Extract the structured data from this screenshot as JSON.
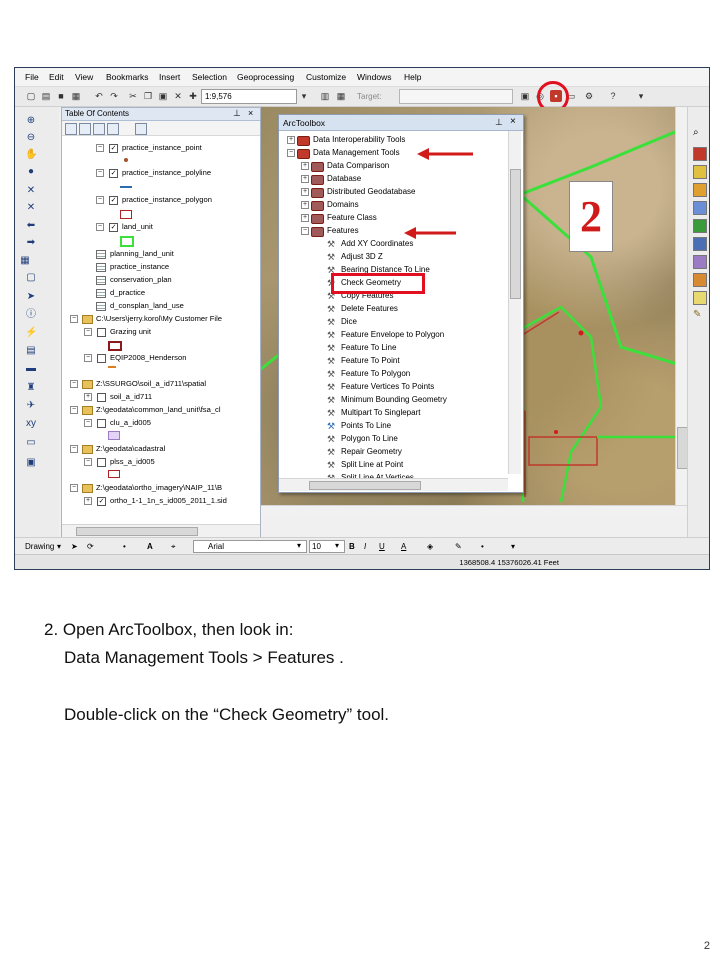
{
  "menu": [
    "File",
    "Edit",
    "View",
    "Bookmarks",
    "Insert",
    "Selection",
    "Geoprocessing",
    "Customize",
    "Windows",
    "Help"
  ],
  "toolbar": {
    "scale": "1:9,576",
    "target_label": "Target:"
  },
  "toc": {
    "title": "Table Of Contents",
    "items": [
      {
        "label": "practice_instance_point",
        "checked": true
      },
      {
        "label": "practice_instance_polyline",
        "checked": true
      },
      {
        "label": "practice_instance_polygon",
        "checked": true
      },
      {
        "label": "land_unit",
        "checked": true
      },
      {
        "label": "planning_land_unit"
      },
      {
        "label": "practice_instance"
      },
      {
        "label": "conservation_plan"
      },
      {
        "label": "d_practice"
      },
      {
        "label": "d_consplan_land_use"
      },
      {
        "label": "C:\\Users\\jerry.korol\\My Customer File"
      },
      {
        "label": "Grazing unit",
        "checked": false
      },
      {
        "label": "EQIP2008_Henderson",
        "checked": false
      },
      {
        "label": "Z:\\SSURGO\\soil_a_id711\\spatial"
      },
      {
        "label": "soil_a_id711",
        "checked": false
      },
      {
        "label": "Z:\\geodata\\common_land_unit\\fsa_cl"
      },
      {
        "label": "clu_a_id005",
        "checked": false
      },
      {
        "label": "Z:\\geodata\\cadastral"
      },
      {
        "label": "plss_a_id005",
        "checked": false
      },
      {
        "label": "Z:\\geodata\\ortho_imagery\\NAIP_11\\B"
      },
      {
        "label": "ortho_1-1_1n_s_id005_2011_1.sid",
        "checked": true
      }
    ]
  },
  "toolbox": {
    "title": "ArcToolbox",
    "groups": [
      "Data Interoperability Tools",
      "Data Management Tools",
      "Data Comparison",
      "Database",
      "Distributed Geodatabase",
      "Domains",
      "Feature Class",
      "Features"
    ],
    "tools": [
      "Add XY Coordinates",
      "Adjust 3D Z",
      "Bearing Distance To Line",
      "Check Geometry",
      "Copy Features",
      "Delete Features",
      "Dice",
      "Feature Envelope to Polygon",
      "Feature To Line",
      "Feature To Point",
      "Feature To Polygon",
      "Feature Vertices To Points",
      "Minimum Bounding Geometry",
      "Multipart To Singlepart",
      "Points To Line",
      "Polygon To Line",
      "Repair Geometry",
      "Split Line at Point",
      "Split Line At Vertices"
    ]
  },
  "drawing": {
    "label": "Drawing",
    "font": "Arial",
    "size": "10",
    "bold": "B",
    "italic": "I",
    "underline": "U"
  },
  "status": {
    "coords": "1368508.4  15376026.41 Feet"
  },
  "callout": "2",
  "caption": {
    "line1": "2. Open ArcToolbox, then look in:",
    "line2": "Data Management Tools  >  Features .",
    "line3": "Double-click on the “Check Geometry” tool."
  },
  "slide_number": "2",
  "colors": {
    "highlight": "#e10f1f",
    "polygon_outline": "#3be03b",
    "title_bar": "#d7e2f1"
  }
}
